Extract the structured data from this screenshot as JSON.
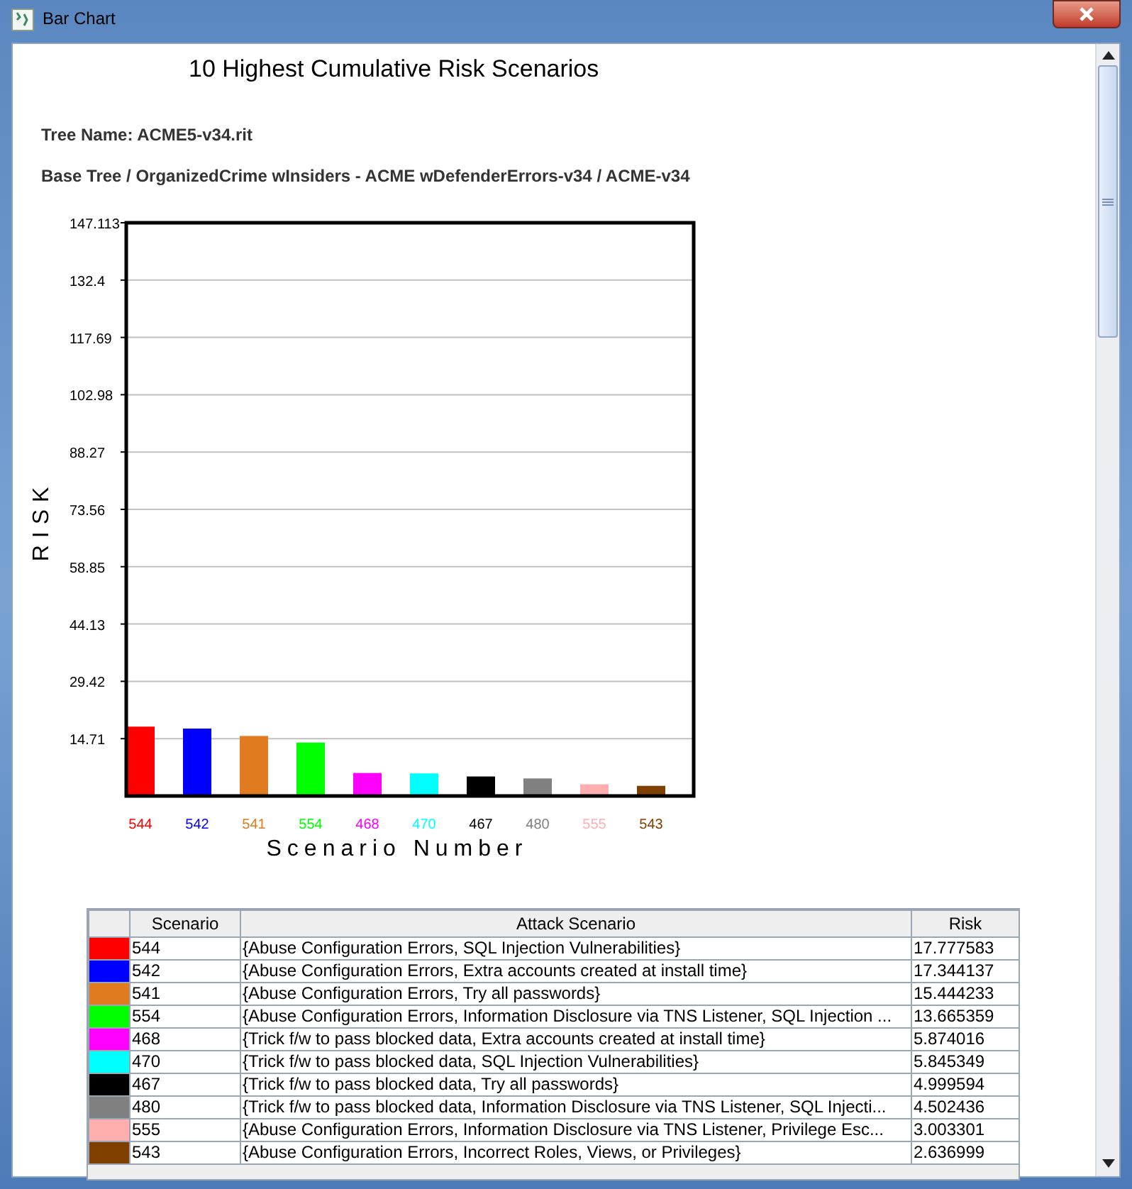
{
  "window": {
    "title": "Bar Chart"
  },
  "report": {
    "title": "10 Highest Cumulative Risk Scenarios",
    "tree_name": "Tree Name: ACME5-v34.rit",
    "base_tree": "Base Tree / OrganizedCrime wInsiders - ACME wDefenderErrors-v34 / ACME-v34"
  },
  "chart_data": {
    "type": "bar",
    "ylabel": "RISK",
    "xlabel": "Scenario Number",
    "categories": [
      "544",
      "542",
      "541",
      "554",
      "468",
      "470",
      "467",
      "480",
      "555",
      "543"
    ],
    "series": [
      {
        "values": [
          17.8,
          17.3,
          15.4,
          13.7,
          5.9,
          5.8,
          5.0,
          4.5,
          3.0,
          2.6
        ]
      }
    ],
    "grid": true,
    "ylim": [
      0,
      147.113
    ],
    "yticks": [
      {
        "value": 147.113,
        "label": "147.113"
      },
      {
        "value": 132.4,
        "label": "132.4"
      },
      {
        "value": 117.69,
        "label": "117.69"
      },
      {
        "value": 102.98,
        "label": "102.98"
      },
      {
        "value": 88.27,
        "label": "88.27"
      },
      {
        "value": 73.56,
        "label": "73.56"
      },
      {
        "value": 58.85,
        "label": "58.85"
      },
      {
        "value": 44.13,
        "label": "44.13"
      },
      {
        "value": 29.42,
        "label": "29.42"
      },
      {
        "value": 14.71,
        "label": "14.71"
      }
    ]
  },
  "table": {
    "columns": [
      "Scenario",
      "Attack Scenario",
      "Risk"
    ],
    "rows": [
      {
        "color": "#ff0000",
        "scenario": "544",
        "attack": "{Abuse Configuration Errors, SQL Injection Vulnerabilities}",
        "risk": "17.777583"
      },
      {
        "color": "#0000ff",
        "scenario": "542",
        "attack": "{Abuse Configuration Errors, Extra accounts created at install time}",
        "risk": "17.344137"
      },
      {
        "color": "#e07b20",
        "scenario": "541",
        "attack": "{Abuse Configuration Errors, Try all passwords}",
        "risk": "15.444233"
      },
      {
        "color": "#00ff00",
        "scenario": "554",
        "attack": "{Abuse Configuration Errors, Information Disclosure via TNS Listener, SQL Injection ...",
        "risk": "13.665359"
      },
      {
        "color": "#ff00ff",
        "scenario": "468",
        "attack": "{Trick f/w to pass blocked data, Extra accounts created at install time}",
        "risk": "5.874016"
      },
      {
        "color": "#00ffff",
        "scenario": "470",
        "attack": "{Trick f/w to pass blocked data, SQL Injection Vulnerabilities}",
        "risk": "5.845349"
      },
      {
        "color": "#000000",
        "scenario": "467",
        "attack": "{Trick f/w to pass blocked data, Try all passwords}",
        "risk": "4.999594"
      },
      {
        "color": "#808080",
        "scenario": "480",
        "attack": "{Trick f/w to pass blocked data, Information Disclosure via TNS Listener, SQL Injecti...",
        "risk": "4.502436"
      },
      {
        "color": "#ffafaf",
        "scenario": "555",
        "attack": "{Abuse Configuration Errors, Information Disclosure via TNS Listener, Privilege Esc...",
        "risk": "3.003301"
      },
      {
        "color": "#7f3f00",
        "scenario": "543",
        "attack": "{Abuse Configuration Errors, Incorrect Roles, Views, or Privileges}",
        "risk": "2.636999"
      }
    ]
  }
}
